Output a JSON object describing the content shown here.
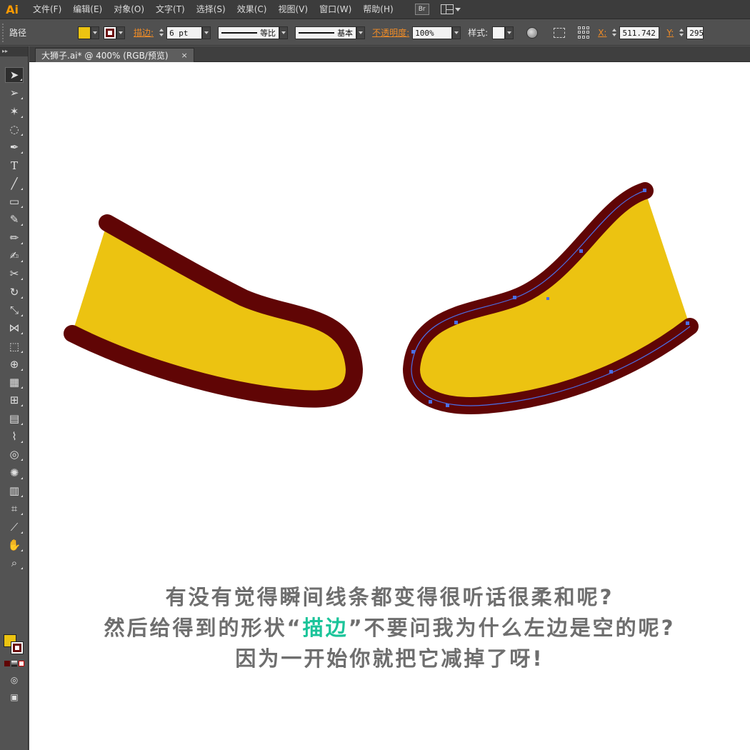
{
  "app": {
    "logo": "Ai"
  },
  "menu": [
    "文件(F)",
    "编辑(E)",
    "对象(O)",
    "文字(T)",
    "选择(S)",
    "效果(C)",
    "视图(V)",
    "窗口(W)",
    "帮助(H)"
  ],
  "menu_extras": {
    "bridge_label": "Br"
  },
  "control_bar": {
    "object_type": "路径",
    "stroke_label": "描边",
    "stroke_weight": "6 pt",
    "variable_width_profile": "等比",
    "brush_definition": "基本",
    "opacity_label": "不透明度",
    "opacity_value": "100%",
    "style_label": "样式",
    "x_label": "X",
    "x_value": "511.742",
    "y_label": "Y",
    "y_value": "295"
  },
  "document_tab": {
    "title": "大狮子.ai* @ 400% (RGB/预览)",
    "close": "×"
  },
  "colors": {
    "fill": "#ecc311",
    "stroke": "#600505",
    "accent": "#1bc49a",
    "selection": "#4b6fe6"
  },
  "tools": [
    "selection-tool",
    "direct-selection-tool",
    "magic-wand-tool",
    "lasso-tool",
    "pen-tool",
    "type-tool",
    "line-segment-tool",
    "rounded-rectangle-tool",
    "paintbrush-tool",
    "pencil-tool",
    "blob-brush-tool",
    "scissors-tool",
    "rotate-tool",
    "scale-tool",
    "width-tool",
    "free-transform-tool",
    "shape-builder-tool",
    "perspective-grid-tool",
    "mesh-tool",
    "gradient-tool",
    "eyedropper-tool",
    "blend-tool",
    "symbol-sprayer-tool",
    "column-graph-tool",
    "artboard-tool",
    "slice-tool",
    "hand-tool",
    "zoom-tool"
  ],
  "caption": {
    "line1": "有没有觉得瞬间线条都变得很听话很柔和呢?",
    "line2_before": "然后给得到的形状“",
    "line2_highlight": "描边",
    "line2_after": "”不要问我为什么左边是空的呢?",
    "line3": "因为一开始你就把它减掉了呀!"
  }
}
